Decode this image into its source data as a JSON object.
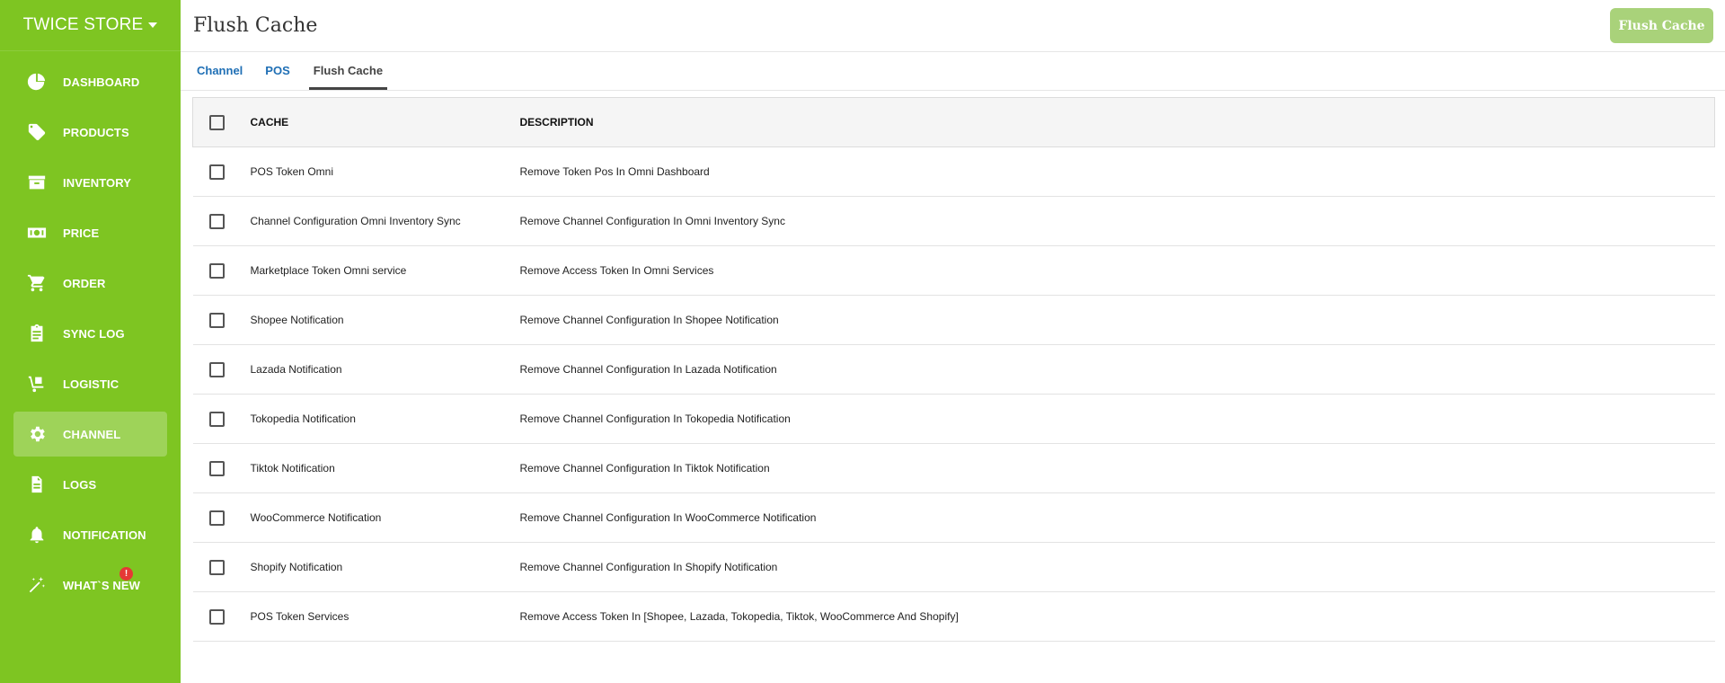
{
  "sidebar": {
    "store_name": "TWICE STORE",
    "items": [
      {
        "label": "DASHBOARD",
        "icon": "pie-chart-icon"
      },
      {
        "label": "PRODUCTS",
        "icon": "tag-icon"
      },
      {
        "label": "INVENTORY",
        "icon": "archive-box-icon"
      },
      {
        "label": "PRICE",
        "icon": "money-icon"
      },
      {
        "label": "ORDER",
        "icon": "cart-icon"
      },
      {
        "label": "SYNC LOG",
        "icon": "clipboard-icon"
      },
      {
        "label": "LOGISTIC",
        "icon": "hand-truck-icon"
      },
      {
        "label": "CHANNEL",
        "icon": "gear-icon",
        "active": true
      },
      {
        "label": "LOGS",
        "icon": "file-icon"
      },
      {
        "label": "NOTIFICATION",
        "icon": "bell-icon"
      },
      {
        "label": "WHAT`S NEW",
        "icon": "magic-wand-icon",
        "badge": "!"
      }
    ]
  },
  "header": {
    "title": "Flush Cache",
    "flush_button": "Flush Cache"
  },
  "tabs": [
    {
      "label": "Channel"
    },
    {
      "label": "POS"
    },
    {
      "label": "Flush Cache",
      "active": true
    }
  ],
  "table": {
    "headers": {
      "cache": "CACHE",
      "description": "DESCRIPTION"
    },
    "rows": [
      {
        "cache": "POS Token Omni",
        "description": "Remove Token Pos In Omni Dashboard"
      },
      {
        "cache": "Channel Configuration Omni Inventory Sync",
        "description": "Remove Channel Configuration In Omni Inventory Sync"
      },
      {
        "cache": "Marketplace Token Omni service",
        "description": "Remove Access Token In Omni Services"
      },
      {
        "cache": "Shopee Notification",
        "description": "Remove Channel Configuration In Shopee Notification"
      },
      {
        "cache": "Lazada Notification",
        "description": "Remove Channel Configuration In Lazada Notification"
      },
      {
        "cache": "Tokopedia Notification",
        "description": "Remove Channel Configuration In Tokopedia Notification"
      },
      {
        "cache": "Tiktok Notification",
        "description": "Remove Channel Configuration In Tiktok Notification"
      },
      {
        "cache": "WooCommerce Notification",
        "description": "Remove Channel Configuration In WooCommerce Notification"
      },
      {
        "cache": "Shopify Notification",
        "description": "Remove Channel Configuration In Shopify Notification"
      },
      {
        "cache": "POS Token Services",
        "description": "Remove Access Token In [Shopee, Lazada, Tokopedia, Tiktok, WooCommerce And Shopify]"
      }
    ]
  },
  "colors": {
    "sidebar_bg": "#7ec522",
    "button_bg": "#a9d27a",
    "tab_link": "#1f6fb5",
    "badge": "#e53935"
  }
}
